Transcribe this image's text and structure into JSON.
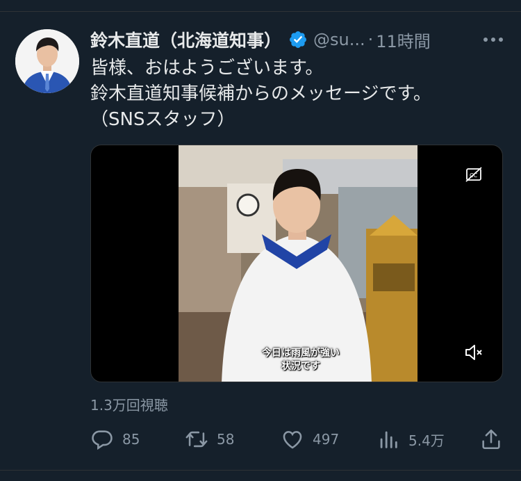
{
  "tweet": {
    "author_name": "鈴木直道（北海道知事）",
    "handle": "@su...",
    "separator": "·",
    "time": "11時間",
    "text_lines": [
      "皆様、おはようございます。",
      "鈴木直道知事候補からのメッセージです。",
      "（SNSスタッフ）"
    ]
  },
  "video": {
    "caption_lines": [
      "今日は雨風が強い",
      "状況です"
    ]
  },
  "views": "1.3万回視聴",
  "actions": {
    "replies": "85",
    "retweets": "58",
    "likes": "497",
    "analytics": "5.4万"
  },
  "colors": {
    "background": "#15202b",
    "text": "#e7e9ea",
    "secondary_text": "#8b98a5",
    "verified_badge": "#1d9bf0"
  },
  "icons": [
    "verified-badge-icon",
    "more-options-icon",
    "closed-caption-icon",
    "mute-icon",
    "reply-icon",
    "retweet-icon",
    "like-icon",
    "analytics-icon",
    "share-icon"
  ]
}
